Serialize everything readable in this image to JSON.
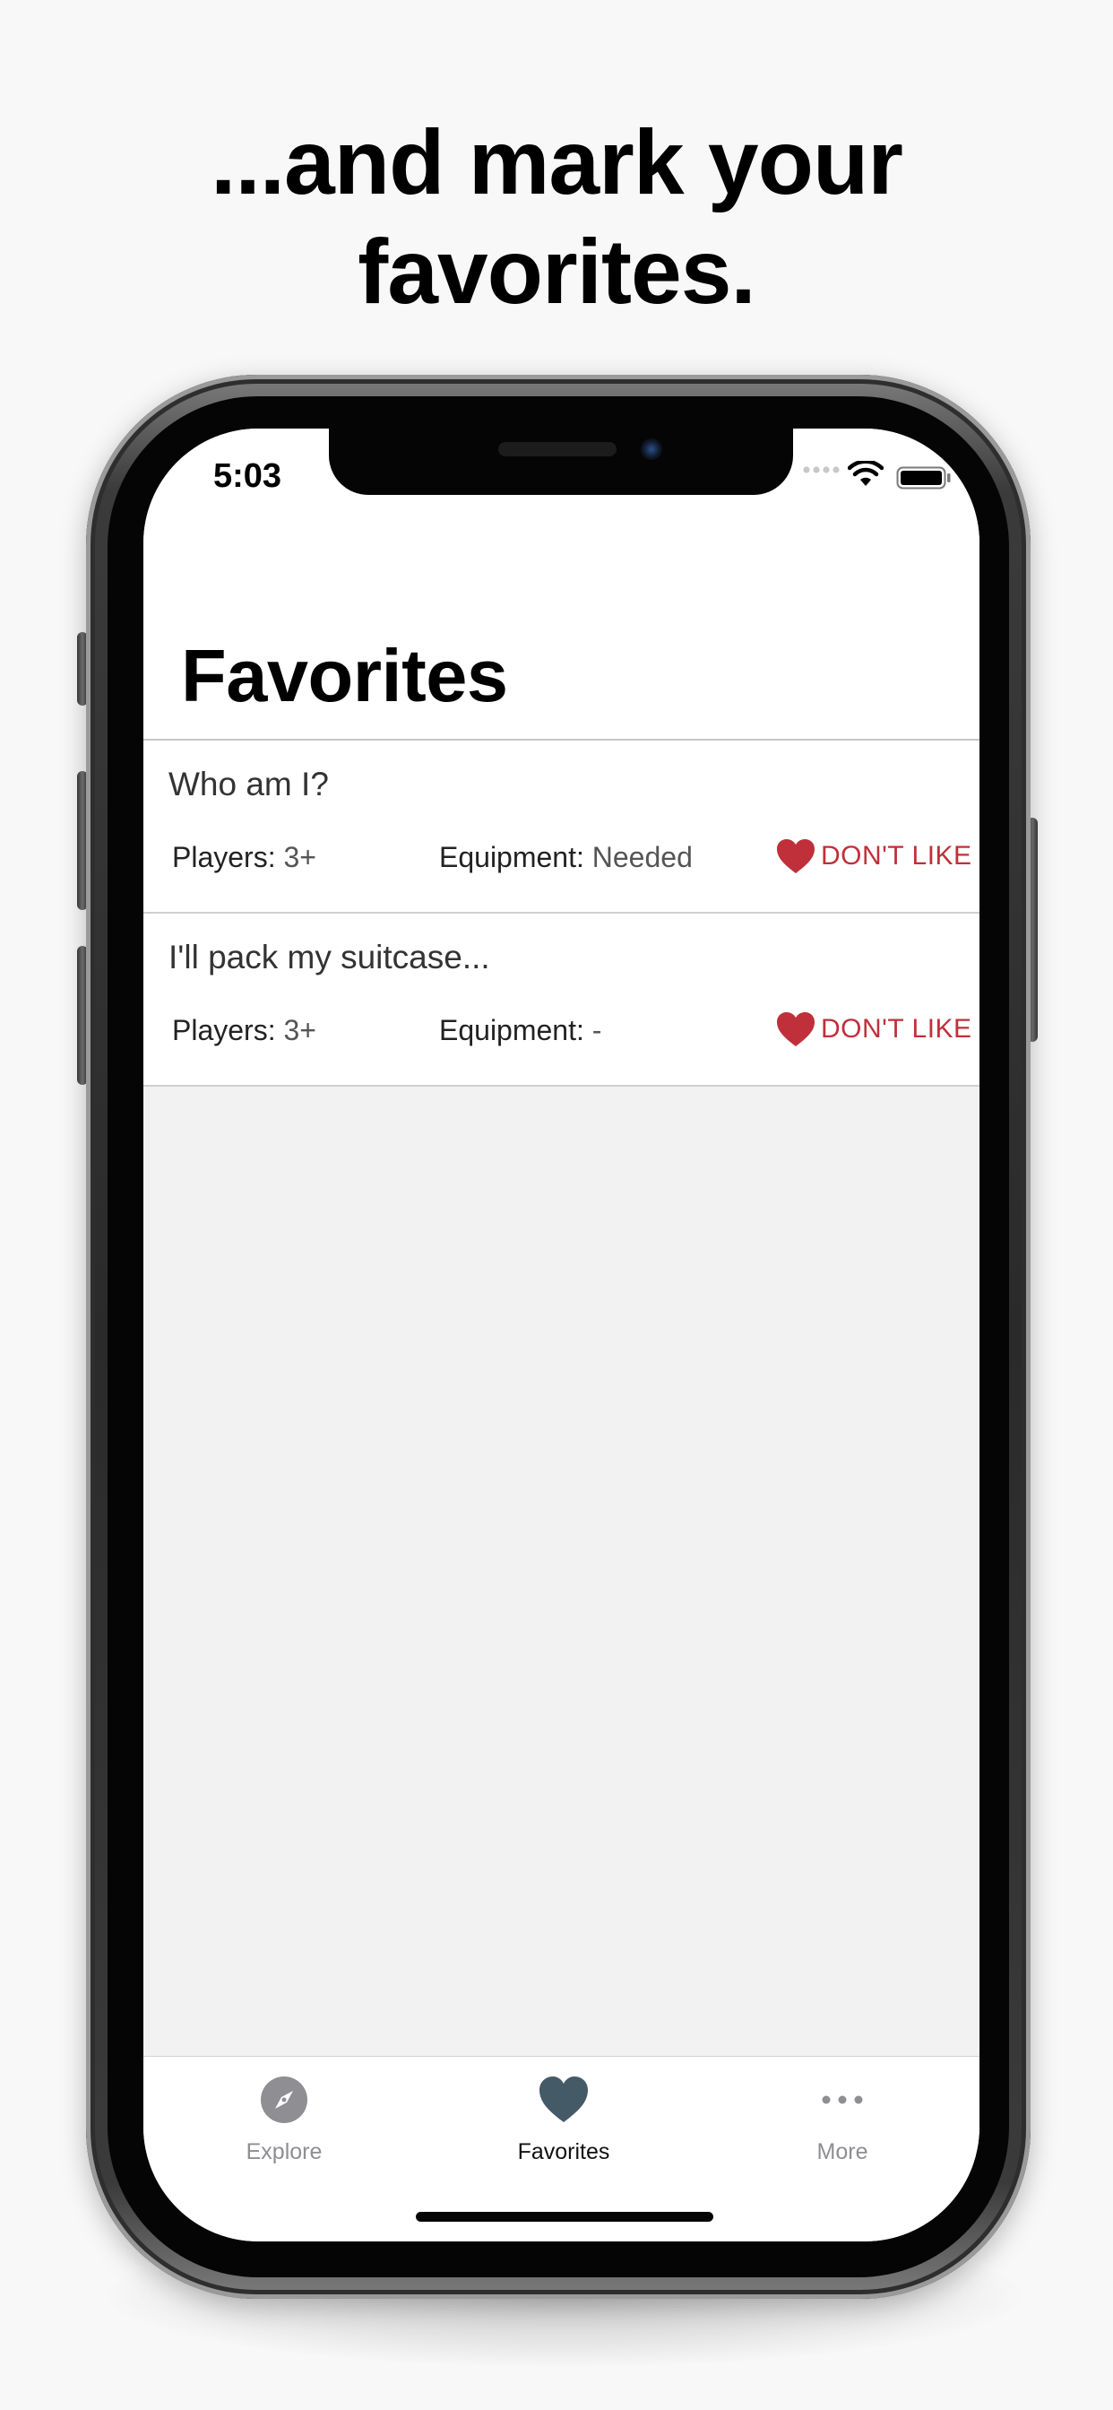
{
  "headline": {
    "line1": "...and mark your",
    "line2": "favorites."
  },
  "status_bar": {
    "time": "5:03"
  },
  "nav": {
    "title": "Favorites"
  },
  "favorites": [
    {
      "title": "Who am I?",
      "players_label": "Players:",
      "players_value": "3+",
      "equipment_label": "Equipment:",
      "equipment_value": "Needed",
      "action_label": "DON'T LIKE"
    },
    {
      "title": "I'll pack my suitcase...",
      "players_label": "Players:",
      "players_value": "3+",
      "equipment_label": "Equipment:",
      "equipment_value": "-",
      "action_label": "DON'T LIKE"
    }
  ],
  "tabbar": {
    "tabs": [
      {
        "label": "Explore",
        "icon": "compass-icon",
        "active": false
      },
      {
        "label": "Favorites",
        "icon": "heart-icon",
        "active": true
      },
      {
        "label": "More",
        "icon": "more-icon",
        "active": false
      }
    ]
  },
  "colors": {
    "accent_red": "#c0303a",
    "active_tab_icon": "#445a66",
    "inactive_tab": "#8e8e93",
    "list_background": "#f2f2f2"
  }
}
